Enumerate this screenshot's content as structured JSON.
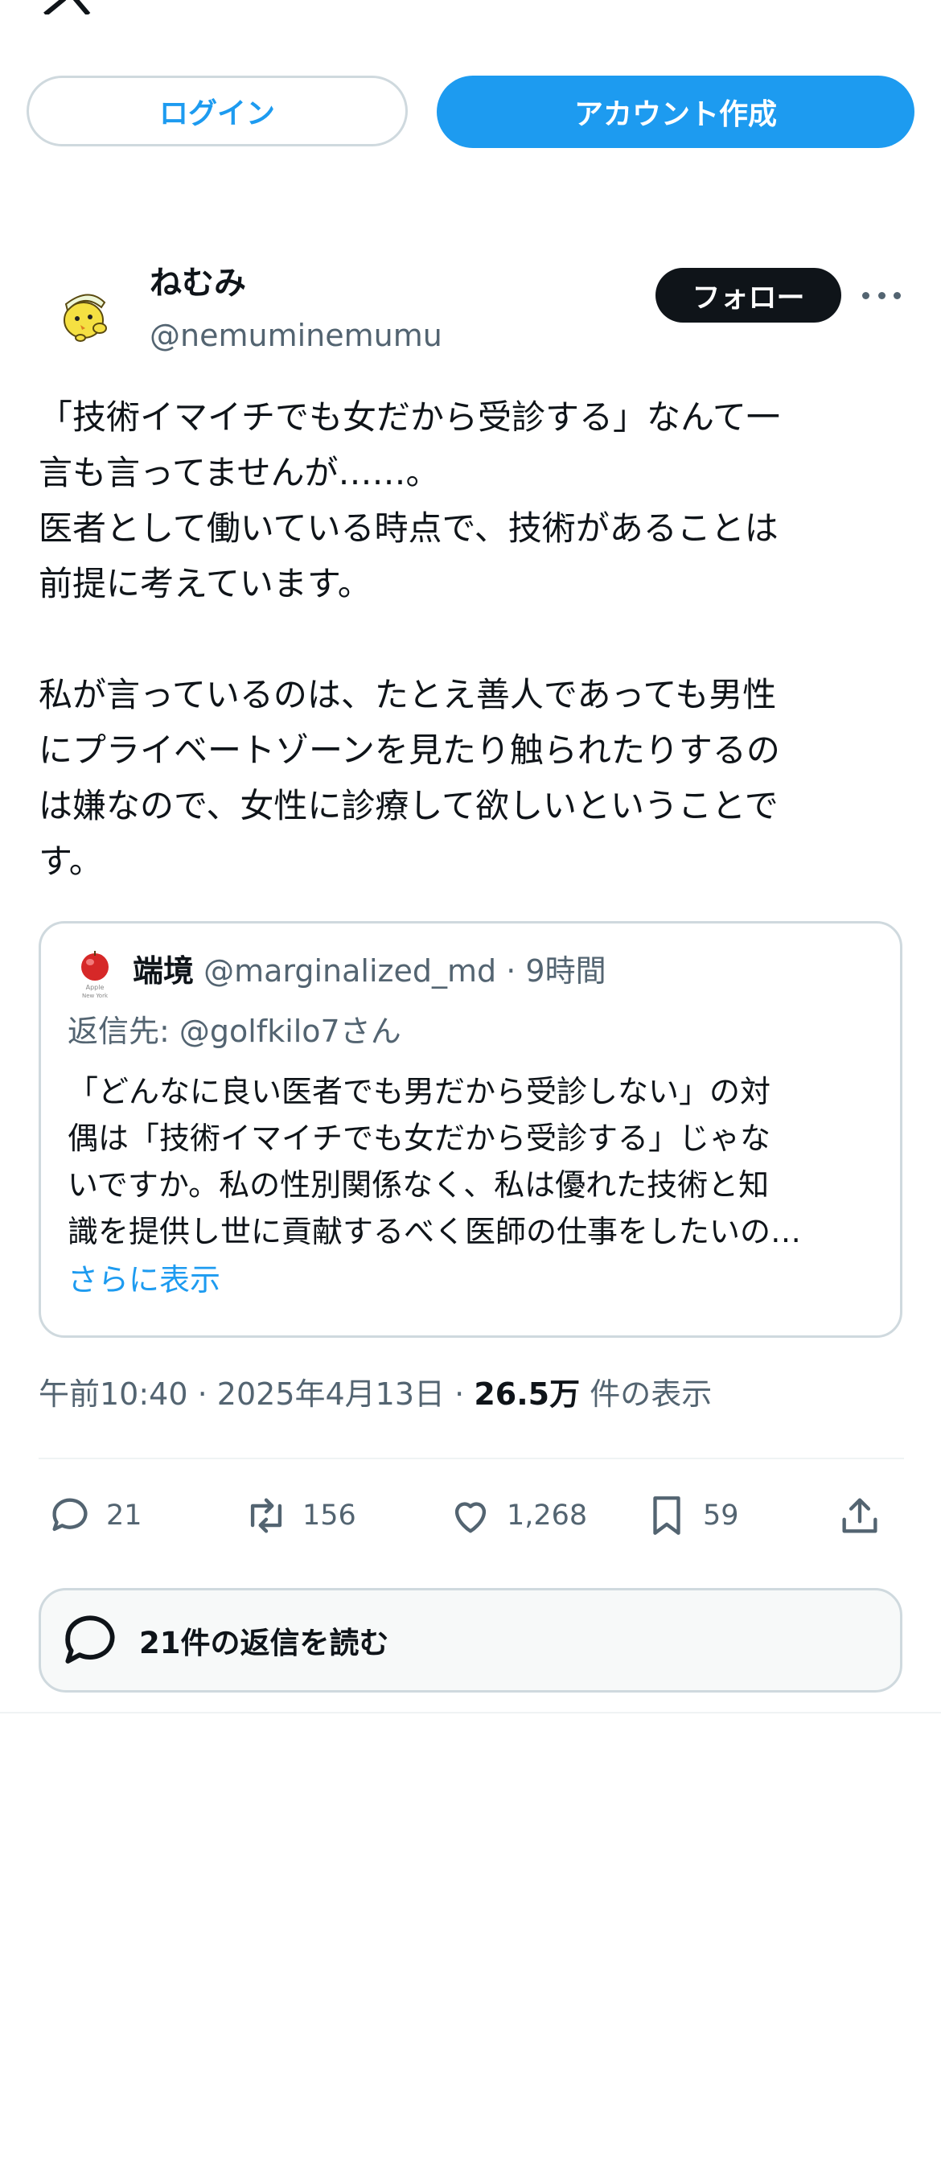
{
  "header": {
    "logo_icon": "x-logo-icon",
    "login_label": "ログイン",
    "signup_label": "アカウント作成"
  },
  "post": {
    "author": {
      "display_name": "ねむみ",
      "handle": "@nemuminemumu",
      "avatar_icon": "yellow-bird-avatar"
    },
    "follow_label": "フォロー",
    "more_icon": "more-dots-icon",
    "text": "「技術イマイチでも女だから受診する」なんて一\n言も言ってませんが……。\n医者として働いている時点で、技術があることは\n前提に考えています。\n\n私が言っているのは、たとえ善人であっても男性\nにプライベートゾーンを見たり触られたりするの\nは嫌なので、女性に診療して欲しいということで\nす。",
    "quote": {
      "avatar_icon": "apple-avatar",
      "avatar_caption": "Apple\nNew York",
      "display_name": "端境",
      "handle": "@marginalized_md",
      "separator": "·",
      "time": "9時間",
      "reply_to": "返信先: @golfkilo7さん",
      "text": "「どんなに良い医者でも男だから受診しない」の対\n偶は「技術イマイチでも女だから受診する」じゃな\nいですか。私の性別関係なく、私は優れた技術と知\n識を提供し世に貢献するべく医師の仕事をしたいの…",
      "show_more": "さらに表示"
    },
    "timestamp": "午前10:40",
    "date": "2025年4月13日",
    "dot": "·",
    "views_count": "26.5万",
    "views_label": "件の表示",
    "actions": {
      "replies": "21",
      "reposts": "156",
      "likes": "1,268",
      "bookmarks": "59"
    },
    "read_replies_label": "21件の返信を読む"
  },
  "colors": {
    "accent": "#1d9bf0",
    "text": "#0f1419",
    "secondary": "#536471",
    "border": "#cfd9de"
  }
}
